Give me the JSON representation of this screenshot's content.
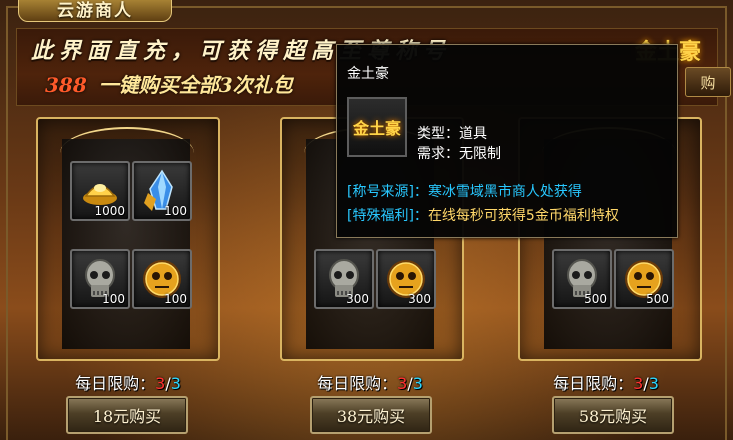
{
  "window": {
    "title": "云游商人"
  },
  "banner": {
    "line1": "此界面直充，可获得超高至尊称号",
    "price": "388",
    "line2": "一键购买全部3次礼包",
    "brand": "金土豪",
    "buy_label": "购"
  },
  "packs": [
    {
      "items": [
        {
          "icon": "gold-ingot-icon",
          "count": "1000"
        },
        {
          "icon": "blue-crystal-icon",
          "count": "100"
        },
        {
          "icon": "silver-skull-icon",
          "count": "100"
        },
        {
          "icon": "gold-skull-icon",
          "count": "100"
        }
      ],
      "limit_label": "每日限购：",
      "limit_used": "3",
      "limit_sep": "/",
      "limit_total": "3",
      "buy_label": "18元购买"
    },
    {
      "items": [
        {
          "icon": "gold-ingot-icon",
          "count": ""
        },
        {
          "icon": "silver-skull-icon",
          "count": "300"
        },
        {
          "icon": "gold-skull-icon",
          "count": "300"
        }
      ],
      "limit_label": "每日限购：",
      "limit_used": "3",
      "limit_sep": "/",
      "limit_total": "3",
      "buy_label": "38元购买"
    },
    {
      "items": [
        {
          "icon": "silver-skull-icon",
          "count": "500"
        },
        {
          "icon": "gold-skull-icon",
          "count": "500"
        }
      ],
      "limit_label": "每日限购：",
      "limit_used": "3",
      "limit_sep": "/",
      "limit_total": "3",
      "buy_label": "58元购买"
    }
  ],
  "tooltip": {
    "title": "金土豪",
    "icon_text": "金土豪",
    "type_label": "类型：",
    "type_value": "道具",
    "req_label": "需求：",
    "req_value": "无限制",
    "source_tag": "[称号来源]：",
    "source_value": "寒冰雪域黑市商人处获得",
    "benefit_tag": "[特殊福利]：",
    "benefit_value": "在线每秒可获得5金币福利特权"
  },
  "colors": {
    "limit_used": "#ff3030",
    "limit_total": "#2cd7ff",
    "tooltip_tag": "#28c8ff",
    "tooltip_benefit": "#ffd86a"
  }
}
